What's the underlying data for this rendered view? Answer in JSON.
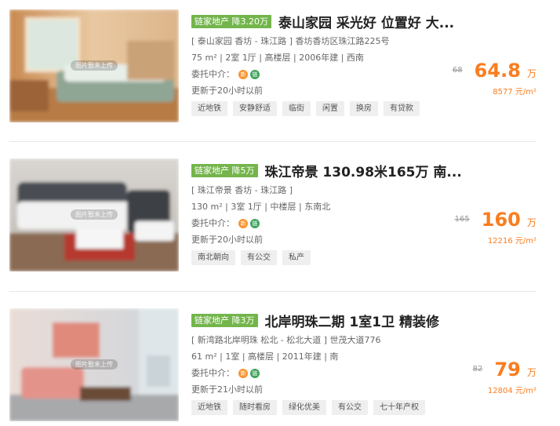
{
  "listings": [
    {
      "badge": "链家地产 降3.20万",
      "title": "泰山家园 采光好 位置好 大...",
      "address": "[ 泰山家园 香坊 - 珠江路 ] 香坊香坊区珠江路225号",
      "details": "75 m² | 2室 1厅 | 高楼层 | 2006年建 | 西南",
      "agent_label": "委托中介：",
      "updated": "更新于20小时以前",
      "tags": [
        "近地铁",
        "安静舒适",
        "临街",
        "闲置",
        "换房",
        "有贷款"
      ],
      "original_price": "68",
      "price": "64.8",
      "price_unit": "万",
      "unit_price": "8577 元/m²",
      "image_placeholder": "图片暂未上传"
    },
    {
      "badge": "链家地产 降5万",
      "title": "珠江帝景 130.98米165万 南...",
      "address": "[ 珠江帝景 香坊 - 珠江路 ]",
      "details": "130 m² | 3室 1厅 | 中楼层 | 东南北",
      "agent_label": "委托中介：",
      "updated": "更新于20小时以前",
      "tags": [
        "南北朝向",
        "有公交",
        "私产"
      ],
      "original_price": "165",
      "price": "160",
      "price_unit": "万",
      "unit_price": "12216 元/m²",
      "image_placeholder": "图片暂未上传"
    },
    {
      "badge": "链家地产 降3万",
      "title": "北岸明珠二期 1室1卫 精装修",
      "address": "[ 新湾路北岸明珠 松北 - 松北大道 ] 世茂大道776",
      "details": "61 m² | 1室 | 高楼层 | 2011年建 | 南",
      "agent_label": "委托中介：",
      "updated": "更新于21小时以前",
      "tags": [
        "近地铁",
        "随时看房",
        "绿化优美",
        "有公交",
        "七十年产权"
      ],
      "original_price": "82",
      "price": "79",
      "price_unit": "万",
      "unit_price": "12804 元/m²",
      "image_placeholder": "图片暂未上传"
    }
  ],
  "agent_icons": [
    "新",
    "链"
  ],
  "colors": {
    "badge_green": "#73b54b",
    "price_orange": "#fa7d1f",
    "tag_bg": "#efefef"
  }
}
